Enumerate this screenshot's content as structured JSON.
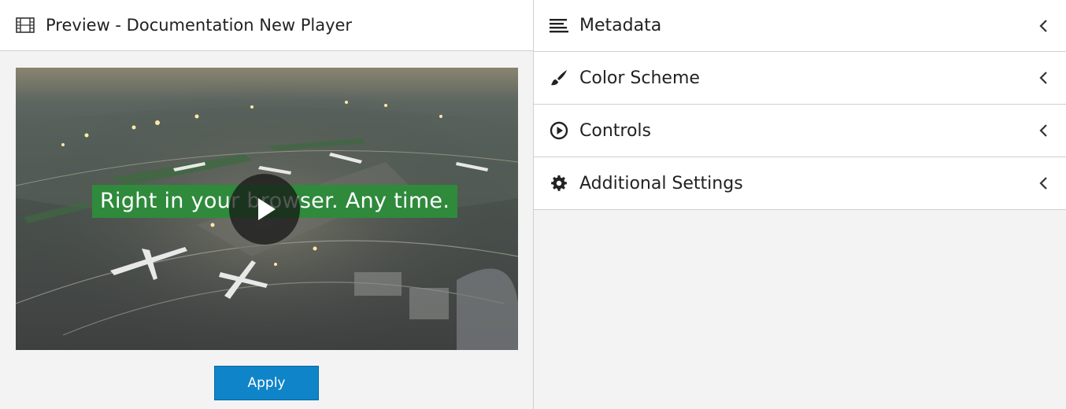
{
  "preview": {
    "title": "Preview - Documentation New Player",
    "caption": "Right in your browser. Any time.",
    "apply_label": "Apply",
    "caption_color": "#2f8a3c",
    "apply_color": "#0f84c8"
  },
  "panels": [
    {
      "label": "Metadata",
      "icon": "list-lines-icon"
    },
    {
      "label": "Color Scheme",
      "icon": "paintbrush-icon"
    },
    {
      "label": "Controls",
      "icon": "play-circle-icon"
    },
    {
      "label": "Additional Settings",
      "icon": "gear-icon"
    }
  ]
}
